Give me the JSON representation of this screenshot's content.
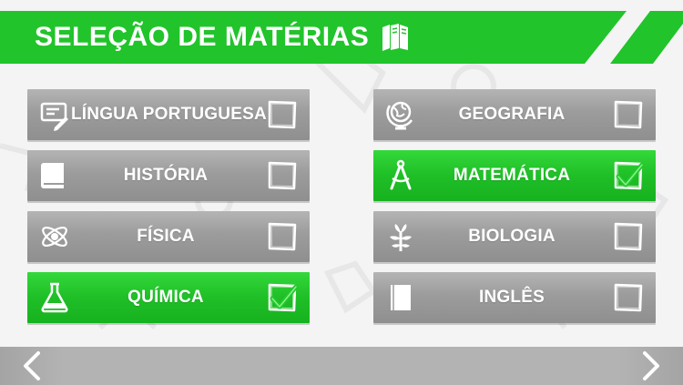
{
  "header": {
    "title": "SELEÇÃO DE MATÉRIAS",
    "icon": "books-icon"
  },
  "colors": {
    "header_green": "#21c42b",
    "selected_green": "#1fbf27",
    "unselected_gray": "#9c9c9c",
    "footer_gray": "#b3b3b3",
    "check_green": "#22c92b"
  },
  "subjects": [
    {
      "label": "LÍNGUA PORTUGUESA",
      "icon": "writing-icon",
      "selected": false
    },
    {
      "label": "GEOGRAFIA",
      "icon": "globe-icon",
      "selected": false
    },
    {
      "label": "HISTÓRIA",
      "icon": "book-icon",
      "selected": false
    },
    {
      "label": "MATEMÁTICA",
      "icon": "compass-icon",
      "selected": true
    },
    {
      "label": "FÍSICA",
      "icon": "atom-icon",
      "selected": false
    },
    {
      "label": "BIOLOGIA",
      "icon": "plant-icon",
      "selected": false
    },
    {
      "label": "QUÍMICA",
      "icon": "flask-icon",
      "selected": true
    },
    {
      "label": "INGLÊS",
      "icon": "notebook-icon",
      "selected": false
    }
  ],
  "footer": {
    "prev_icon": "chevron-left-icon",
    "next_icon": "chevron-right-icon"
  }
}
